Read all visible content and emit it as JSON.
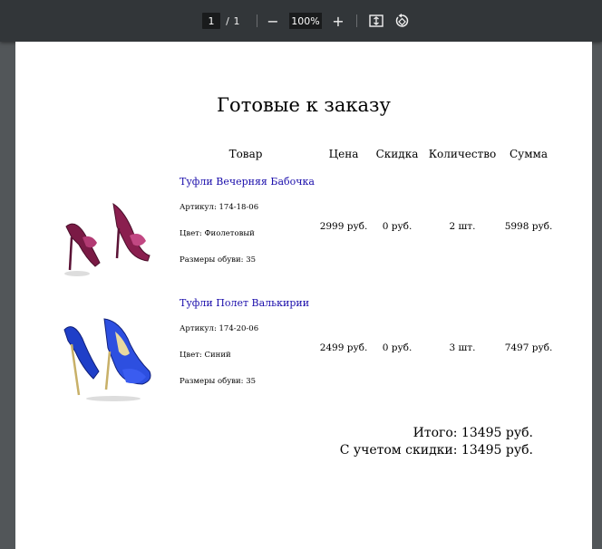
{
  "toolbar": {
    "current_page": "1",
    "page_separator": "/",
    "total_pages": "1",
    "zoom_out": "−",
    "zoom_level": "100%",
    "zoom_in": "+"
  },
  "document": {
    "title": "Готовые к заказу",
    "columns": {
      "product": "Товар",
      "price": "Цена",
      "discount": "Скидка",
      "quantity": "Количество",
      "sum": "Сумма"
    },
    "items": [
      {
        "name": "Туфли Вечерняя Бабочка",
        "article": "Артикул: 174-18-06",
        "color": "Цвет: Фиолетовый",
        "size": "Размеры обуви: 35",
        "price": "2999 руб.",
        "discount": "0 руб.",
        "quantity": "2 шт.",
        "sum": "5998 руб.",
        "shoe_color": "#8a1f4f"
      },
      {
        "name": "Туфли Полет Валькирии",
        "article": "Артикул: 174-20-06",
        "color": "Цвет: Синий",
        "size": "Размеры обуви: 35",
        "price": "2499 руб.",
        "discount": "0 руб.",
        "quantity": "3 шт.",
        "sum": "7497 руб.",
        "shoe_color": "#1f3fc8"
      }
    ],
    "total": "Итого: 13495 руб.",
    "total_discount": "С учетом скидки: 13495 руб."
  }
}
